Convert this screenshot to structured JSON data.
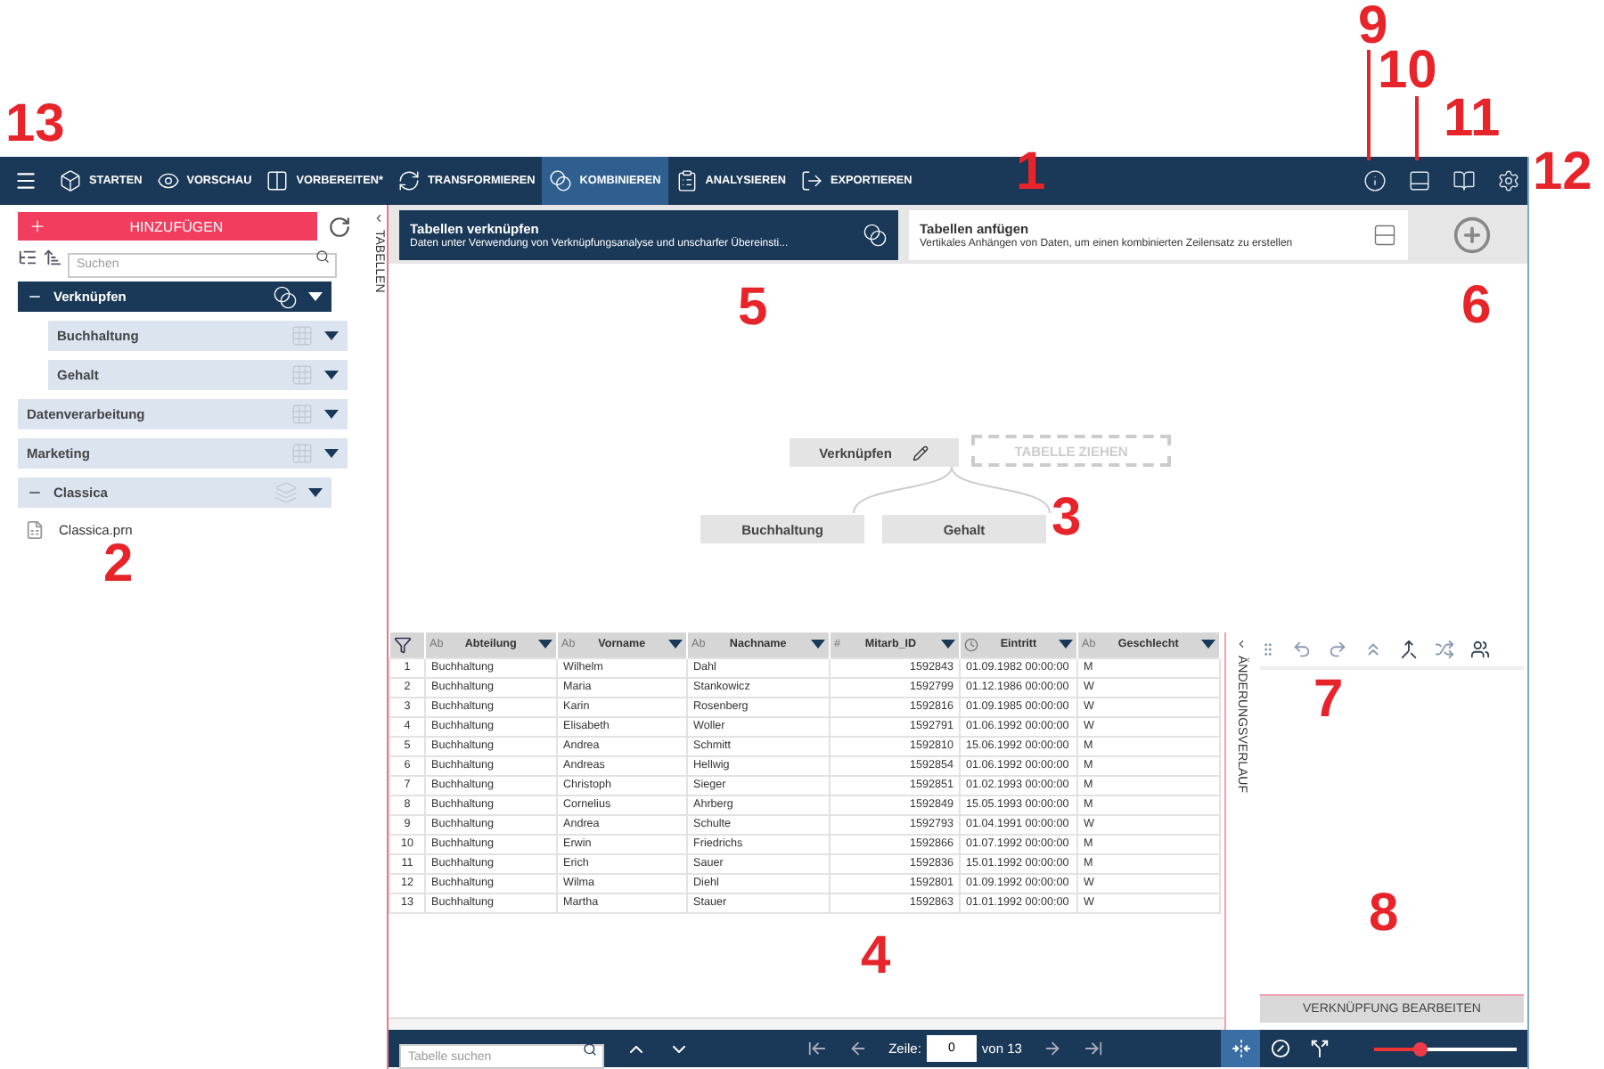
{
  "nav": {
    "items": [
      {
        "kind": "box",
        "label": "STARTEN",
        "selected": false
      },
      {
        "kind": "eye",
        "label": "VORSCHAU",
        "selected": false
      },
      {
        "kind": "columns",
        "label": "VORBEREITEN*",
        "selected": false
      },
      {
        "kind": "cycle",
        "label": "TRANSFORMIEREN",
        "selected": false
      },
      {
        "kind": "blend",
        "label": "KOMBINIEREN",
        "selected": true
      },
      {
        "kind": "clipboard",
        "label": "ANALYSIEREN",
        "selected": false
      },
      {
        "kind": "export",
        "label": "EXPORTIEREN",
        "selected": false
      }
    ]
  },
  "sidebar": {
    "add_button": "HINZUFÜGEN",
    "search": {
      "placeholder": "Suchen"
    },
    "strip_label": "TABELLEN",
    "tree": [
      {
        "kind": "join",
        "label": "Verknüpfen",
        "selected": true,
        "children": [
          {
            "kind": "table",
            "label": "Buchhaltung",
            "selected": false
          },
          {
            "kind": "table",
            "label": "Gehalt",
            "selected": false
          }
        ]
      },
      {
        "kind": "table",
        "label": "Datenverarbeitung",
        "selected": false
      },
      {
        "kind": "table",
        "label": "Marketing",
        "selected": false
      },
      {
        "kind": "stack",
        "label": "Classica",
        "selected": false,
        "children": [
          {
            "kind": "file",
            "label": "Classica.prn",
            "selected": false
          }
        ]
      }
    ]
  },
  "cards": [
    {
      "title": "Tabellen verknüpfen",
      "subtitle": "Daten unter Verwendung von Verknüpfungsanalyse und unscharfer Übereinsti...",
      "kind": "join",
      "selected": true
    },
    {
      "title": "Tabellen anfügen",
      "subtitle": "Vertikales Anhängen von Daten, um einen kombinierten Zeilensatz zu erstellen",
      "kind": "append",
      "selected": false
    }
  ],
  "canvas": {
    "join_node": "Verknüpfen",
    "drop_target": "TABELLE ZIEHEN",
    "inputs": [
      "Buchhaltung",
      "Gehalt"
    ]
  },
  "table": {
    "columns": [
      {
        "kind": "filter"
      },
      {
        "kind": "text",
        "glyph": "Ab",
        "label": "Abteilung"
      },
      {
        "kind": "text",
        "glyph": "Ab",
        "label": "Vorname"
      },
      {
        "kind": "text",
        "glyph": "Ab",
        "label": "Nachname"
      },
      {
        "kind": "number",
        "glyph": "#",
        "label": "Mitarb_ID"
      },
      {
        "kind": "date",
        "label": "Eintritt"
      },
      {
        "kind": "text",
        "glyph": "Ab",
        "label": "Geschlecht"
      }
    ],
    "rows": [
      [
        "1",
        "Buchhaltung",
        "Wilhelm",
        "Dahl",
        "1592843",
        "01.09.1982 00:00:00",
        "M"
      ],
      [
        "2",
        "Buchhaltung",
        "Maria",
        "Stankowicz",
        "1592799",
        "01.12.1986 00:00:00",
        "W"
      ],
      [
        "3",
        "Buchhaltung",
        "Karin",
        "Rosenberg",
        "1592816",
        "01.09.1985 00:00:00",
        "W"
      ],
      [
        "4",
        "Buchhaltung",
        "Elisabeth",
        "Woller",
        "1592791",
        "01.06.1992 00:00:00",
        "W"
      ],
      [
        "5",
        "Buchhaltung",
        "Andrea",
        "Schmitt",
        "1592810",
        "15.06.1992 00:00:00",
        "M"
      ],
      [
        "6",
        "Buchhaltung",
        "Andreas",
        "Hellwig",
        "1592854",
        "01.06.1992 00:00:00",
        "M"
      ],
      [
        "7",
        "Buchhaltung",
        "Christoph",
        "Sieger",
        "1592851",
        "01.02.1993 00:00:00",
        "M"
      ],
      [
        "8",
        "Buchhaltung",
        "Cornelius",
        "Ahrberg",
        "1592849",
        "15.05.1993 00:00:00",
        "M"
      ],
      [
        "9",
        "Buchhaltung",
        "Andrea",
        "Schulte",
        "1592793",
        "01.04.1991 00:00:00",
        "W"
      ],
      [
        "10",
        "Buchhaltung",
        "Erwin",
        "Friedrichs",
        "1592866",
        "01.07.1992 00:00:00",
        "M"
      ],
      [
        "11",
        "Buchhaltung",
        "Erich",
        "Sauer",
        "1592836",
        "15.01.1992 00:00:00",
        "M"
      ],
      [
        "12",
        "Buchhaltung",
        "Wilma",
        "Diehl",
        "1592801",
        "01.09.1992 00:00:00",
        "W"
      ],
      [
        "13",
        "Buchhaltung",
        "Martha",
        "Stauer",
        "1592863",
        "01.01.1992 00:00:00",
        "W"
      ]
    ]
  },
  "history": {
    "label": "ÄNDERUNGSVERLAUF",
    "edit_button": "VERKNÜPFUNG BEARBEITEN"
  },
  "bottom_bar": {
    "search": {
      "placeholder": "Tabelle suchen"
    },
    "row_label": "Zeile:",
    "row_value": "0",
    "row_total": "von 13",
    "toggles": [
      {
        "kind": "fit",
        "selected": true
      },
      {
        "kind": "null",
        "selected": false
      },
      {
        "kind": "split",
        "selected": false
      }
    ],
    "zoom": {
      "level": 0.33
    }
  },
  "callouts": [
    "9",
    "10",
    "11",
    "13",
    "1",
    "12",
    "5",
    "6",
    "3",
    "2",
    "7",
    "8",
    "4"
  ]
}
